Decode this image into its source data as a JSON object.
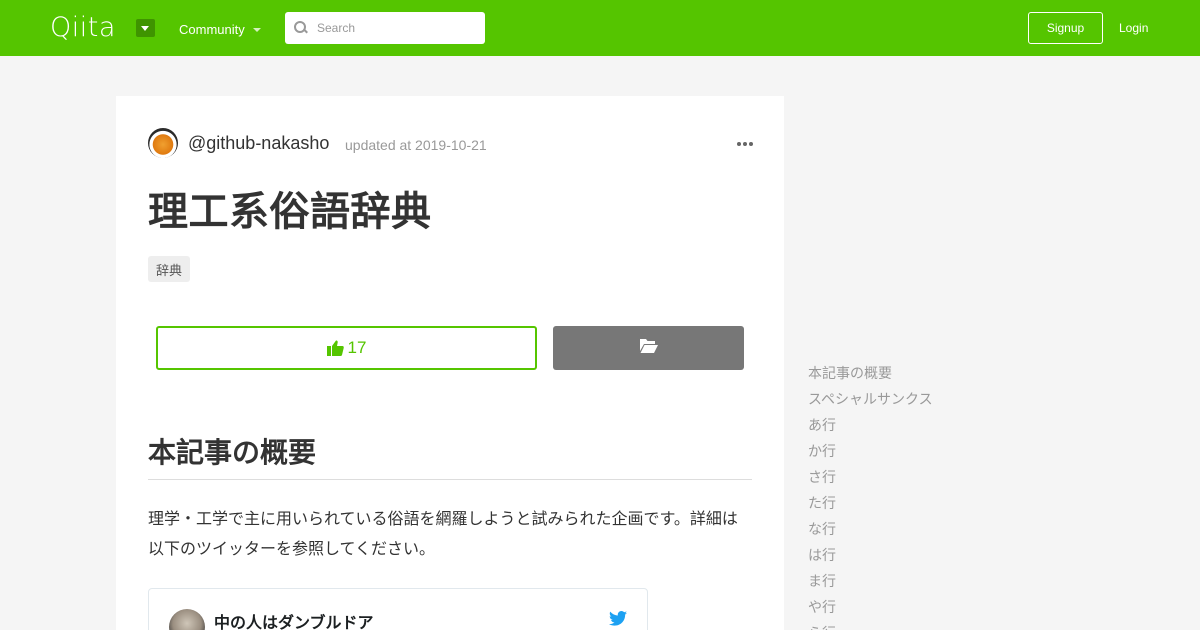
{
  "header": {
    "logo_text": "Qiita",
    "community_label": "Community",
    "search_placeholder": "Search",
    "signup_label": "Signup",
    "login_label": "Login",
    "brand_color": "#55c500"
  },
  "article": {
    "username": "@github-nakasho",
    "updated_text": "updated at 2019-10-21",
    "title": "理工系俗語辞典",
    "tags": [
      "辞典"
    ],
    "like_count": "17",
    "section_heading": "本記事の概要",
    "paragraph": "理学・工学で主に用いられている俗語を網羅しようと試みられた企画です。詳細は以下のツイッターを参照してください。",
    "tweet": {
      "author_name": "中の人はダンブルドア"
    }
  },
  "toc": {
    "items": [
      "本記事の概要",
      "スペシャルサンクス",
      "あ行",
      "か行",
      "さ行",
      "た行",
      "な行",
      "は行",
      "ま行",
      "や行",
      "ら行"
    ]
  },
  "icons": {
    "like": "thumbs-up-icon",
    "stock": "folder-open-icon",
    "more": "ellipsis-icon",
    "search": "search-icon",
    "twitter": "twitter-bird-icon"
  }
}
